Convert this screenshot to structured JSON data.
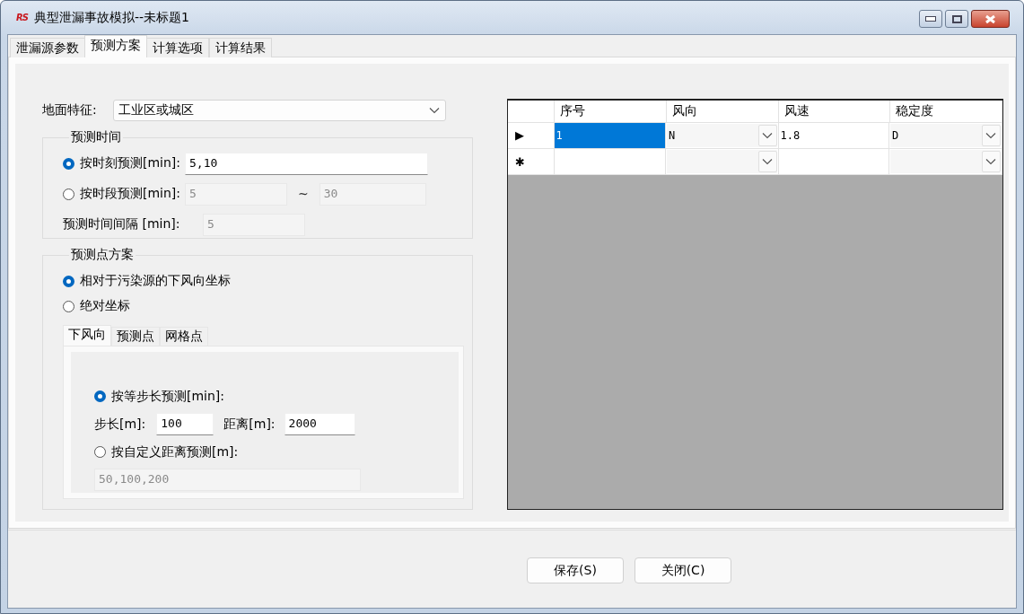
{
  "window": {
    "logo": "RS",
    "title": "典型泄漏事故模拟--未标题1"
  },
  "tabs": [
    {
      "label": "泄漏源参数",
      "selected": false
    },
    {
      "label": "预测方案",
      "selected": true
    },
    {
      "label": "计算选项",
      "selected": false
    },
    {
      "label": "计算结果",
      "selected": false
    }
  ],
  "ground": {
    "label": "地面特征:",
    "value": "工业区或城区"
  },
  "time_group": {
    "title": "预测时间",
    "options": [
      {
        "label": "按时刻预测[min]:",
        "selected": true,
        "fields": [
          {
            "value": "5,10",
            "disabled": false
          }
        ]
      },
      {
        "label": "按时段预测[min]:",
        "selected": false,
        "fields": [
          {
            "value": "5",
            "disabled": true
          },
          {
            "separator": "~",
            "value": "30",
            "disabled": true
          }
        ]
      }
    ],
    "interval": {
      "label": "预测时间间隔 [min]:",
      "value": "5",
      "disabled": true
    }
  },
  "point_group": {
    "title": "预测点方案",
    "options": [
      {
        "label": "相对于污染源的下风向坐标",
        "selected": true
      },
      {
        "label": "绝对坐标",
        "selected": false
      }
    ],
    "subtabs": [
      {
        "label": "下风向",
        "selected": true
      },
      {
        "label": "预测点",
        "selected": false
      },
      {
        "label": "网格点",
        "selected": false
      }
    ],
    "step_options": [
      {
        "label": "按等步长预测[min]:",
        "selected": true,
        "fields": [
          {
            "label": "步长[m]:",
            "value": "100",
            "disabled": false
          },
          {
            "label": "距离[m]:",
            "value": "2000",
            "disabled": false
          }
        ]
      },
      {
        "label": "按自定义距离预测[m]:",
        "selected": false,
        "fields": [
          {
            "value": "50,100,200",
            "disabled": true
          }
        ]
      }
    ]
  },
  "table": {
    "columns": [
      {
        "label": "序号",
        "kind": "text"
      },
      {
        "label": "风向",
        "kind": "combo"
      },
      {
        "label": "风速",
        "kind": "text"
      },
      {
        "label": "稳定度",
        "kind": "combo"
      }
    ],
    "rows": [
      {
        "header": "▶",
        "cells": [
          {
            "value": "1",
            "selected": true
          },
          {
            "value": "N",
            "selected": false
          },
          {
            "value": "1.8",
            "selected": false
          },
          {
            "value": "D",
            "selected": false
          }
        ]
      },
      {
        "header": "✱",
        "cells": [
          {
            "selected": false
          },
          {
            "selected": false
          },
          {
            "selected": false
          },
          {
            "selected": false
          }
        ]
      }
    ]
  },
  "buttons": [
    "保存(S)",
    "关闭(C)"
  ]
}
